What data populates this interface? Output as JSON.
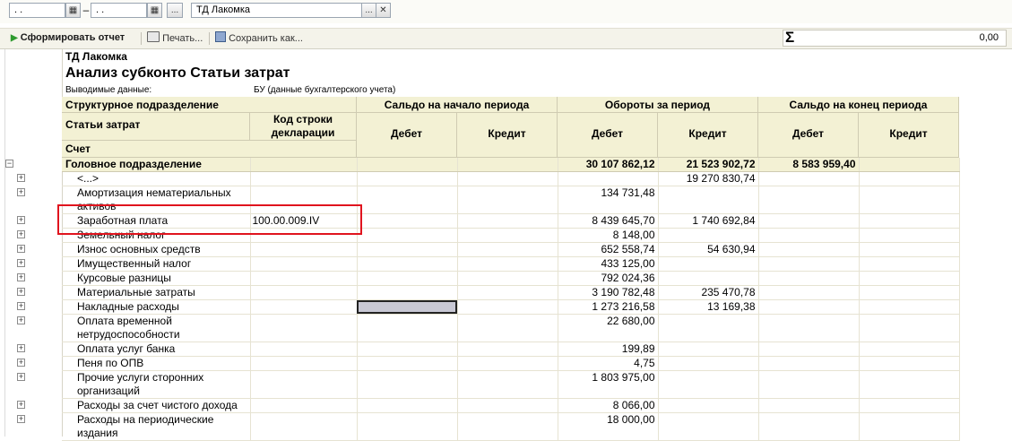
{
  "filter": {
    "date_from": ". .",
    "date_to": ". .",
    "org_button": "...",
    "org_value": "ТД Лакомка",
    "dropdown_glyph": "...",
    "clear_glyph": "✕"
  },
  "toolbar": {
    "generate_label": "Сформировать отчет",
    "print_label": "Печать...",
    "save_label": "Сохранить как...",
    "sum_symbol": "Σ",
    "sum_value": "0,00"
  },
  "report": {
    "org": "ТД Лакомка",
    "title": "Анализ субконто Статьи затрат",
    "output_label": "Выводимые данные:",
    "output_value": "БУ (данные бухгалтерского учета)"
  },
  "headers": {
    "struct": "Структурное подразделение",
    "articles": "Статьи затрат",
    "code": "Код строки декларации",
    "account": "Счет",
    "opening": "Сальдо на начало периода",
    "turnover": "Обороты за период",
    "closing": "Сальдо на конец периода",
    "debit": "Дебет",
    "credit": "Кредит"
  },
  "group": {
    "name": "Головное подразделение",
    "turn_debit": "30 107 862,12",
    "turn_credit": "21 523 902,72",
    "close_debit": "8 583 959,40"
  },
  "rows": [
    {
      "name": "<...>",
      "code": "",
      "turn_debit": "",
      "turn_credit": "19 270 830,74"
    },
    {
      "name": "Амортизация нематериальных активов",
      "code": "",
      "turn_debit": "134 731,48",
      "turn_credit": ""
    },
    {
      "name": "Заработная плата",
      "code": "100.00.009.IV",
      "turn_debit": "8 439 645,70",
      "turn_credit": "1 740 692,84"
    },
    {
      "name": "Земельный налог",
      "code": "",
      "turn_debit": "8 148,00",
      "turn_credit": ""
    },
    {
      "name": "Износ основных средств",
      "code": "",
      "turn_debit": "652 558,74",
      "turn_credit": "54 630,94"
    },
    {
      "name": "Имущественный налог",
      "code": "",
      "turn_debit": "433 125,00",
      "turn_credit": ""
    },
    {
      "name": "Курсовые разницы",
      "code": "",
      "turn_debit": "792 024,36",
      "turn_credit": ""
    },
    {
      "name": "Материальные затраты",
      "code": "",
      "turn_debit": "3 190 782,48",
      "turn_credit": "235 470,78"
    },
    {
      "name": "Накладные расходы",
      "code": "",
      "turn_debit": "1 273 216,58",
      "turn_credit": "13 169,38"
    },
    {
      "name": "Оплата временной нетрудоспособности",
      "code": "",
      "turn_debit": "22 680,00",
      "turn_credit": ""
    },
    {
      "name": "Оплата услуг банка",
      "code": "",
      "turn_debit": "199,89",
      "turn_credit": ""
    },
    {
      "name": "Пеня по ОПВ",
      "code": "",
      "turn_debit": "4,75",
      "turn_credit": ""
    },
    {
      "name": "Прочие услуги сторонних организаций",
      "code": "",
      "turn_debit": "1 803 975,00",
      "turn_credit": ""
    },
    {
      "name": "Расходы за счет чистого дохода",
      "code": "",
      "turn_debit": "8 066,00",
      "turn_credit": ""
    },
    {
      "name": "Расходы на периодические издания",
      "code": "",
      "turn_debit": "18 000,00",
      "turn_credit": ""
    }
  ],
  "tree": {
    "minus": "−",
    "plus": "+"
  }
}
